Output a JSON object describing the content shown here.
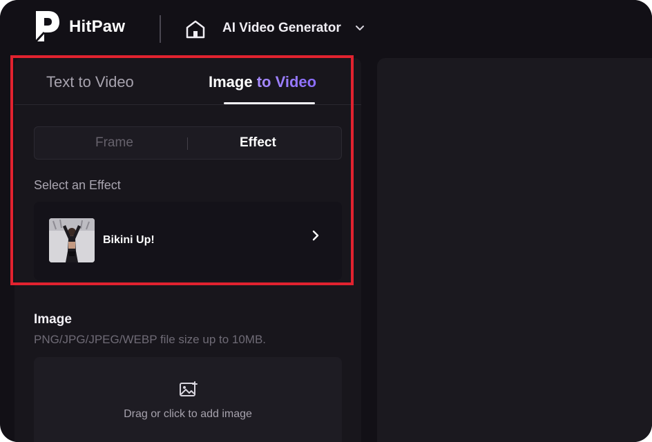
{
  "brand": {
    "name": "HitPaw"
  },
  "app": {
    "title": "AI Video Generator"
  },
  "tabs": [
    {
      "label": "Text to Video",
      "active": false
    },
    {
      "label_start": "Image",
      "label_end": "to Video",
      "active": true
    }
  ],
  "segmented": {
    "frame_label": "Frame",
    "effect_label": "Effect",
    "selected": "Effect"
  },
  "effect": {
    "section_label": "Select an Effect",
    "selected_name": "Bikini Up!"
  },
  "image": {
    "title": "Image",
    "hint": "PNG/JPG/JPEG/WEBP file size up to 10MB.",
    "dropzone_text": "Drag or click to add image"
  },
  "icons": {
    "logo": "hitpaw-logo-icon",
    "home": "home-icon",
    "dropdown": "chevron-down-icon",
    "next": "chevron-right-icon",
    "add_image": "add-image-icon"
  },
  "colors": {
    "background": "#121016",
    "panel": "#18161c",
    "accent_gradient_start": "#a88cff",
    "accent_gradient_end": "#8a6cff",
    "highlight_border": "#e1222f"
  }
}
